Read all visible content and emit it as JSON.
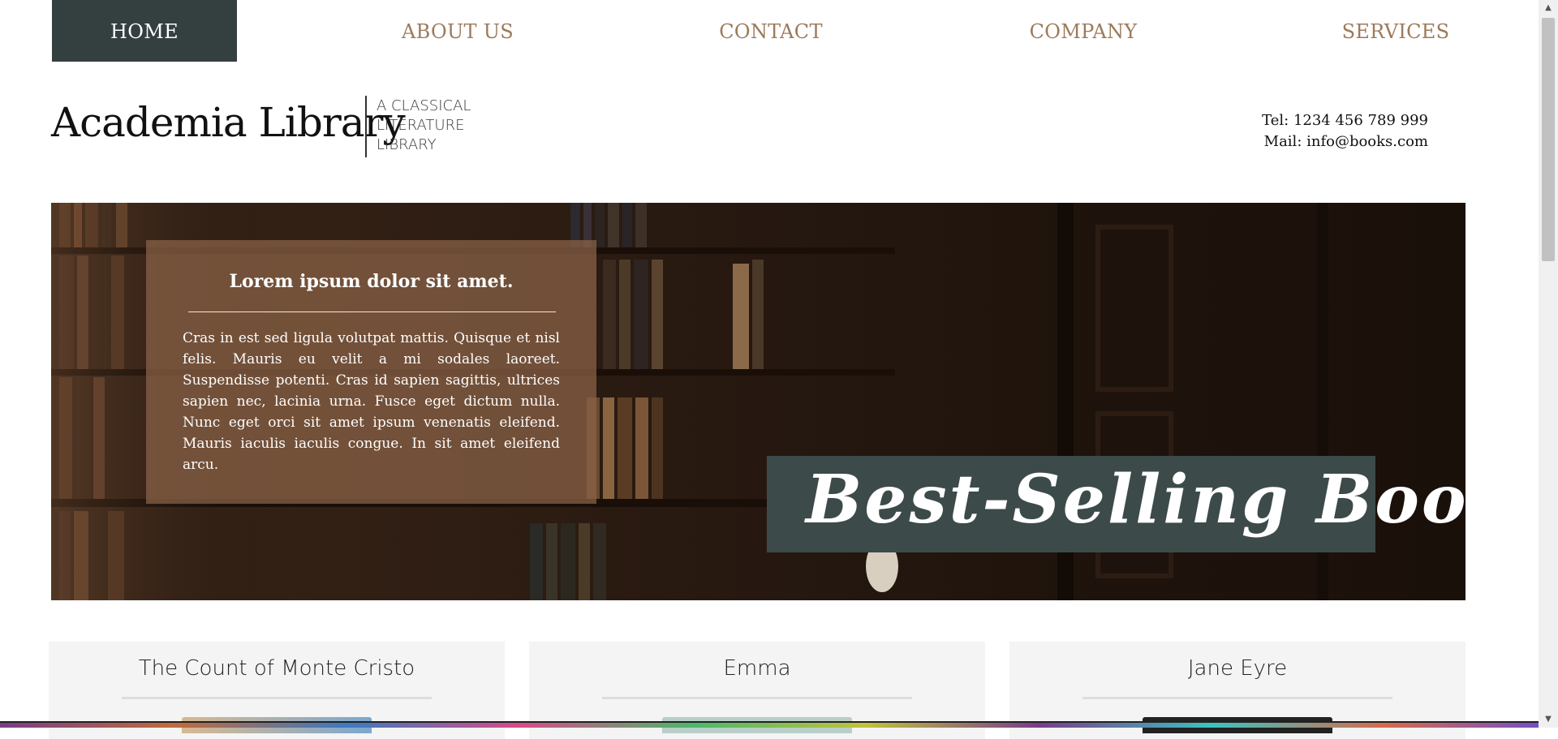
{
  "nav": {
    "items": [
      {
        "label": "HOME",
        "active": true
      },
      {
        "label": "ABOUT US",
        "active": false
      },
      {
        "label": "CONTACT",
        "active": false
      },
      {
        "label": "COMPANY",
        "active": false
      },
      {
        "label": "SERVICES",
        "active": false
      }
    ]
  },
  "header": {
    "site_title": "Academia Library",
    "tagline_lines": [
      "A CLASSICAL",
      "LITERATURE",
      "LIBRARY"
    ],
    "tel": "Tel: 1234 456 789 999",
    "mail": "Mail: info@books.com"
  },
  "hero": {
    "box_title": "Lorem ipsum dolor sit amet.",
    "box_text": "Cras in est sed ligula volutpat mattis. Quisque et nisl felis. Mauris eu velit a mi sodales laoreet. Suspendisse potenti. Cras id sapien sagittis, ultrices sapien nec, lacinia urna. Fusce eget dictum nulla. Nunc eget orci sit amet ipsum venenatis eleifend. Mauris iaculis iaculis congue. In sit amet eleifend arcu.",
    "banner_text": "Best-Selling Books"
  },
  "cards": [
    {
      "title": "The Count of Monte Cristo"
    },
    {
      "title": "Emma"
    },
    {
      "title": "Jane Eyre"
    }
  ],
  "colors": {
    "nav_active_bg": "#343f3f",
    "nav_text": "#9c7a5a",
    "banner_bg": "#3c4a4a",
    "hero_box_bg": "#8c6448"
  },
  "icons": {
    "scroll_up": "scroll-up-arrow-icon",
    "scroll_down": "scroll-down-arrow-icon"
  }
}
